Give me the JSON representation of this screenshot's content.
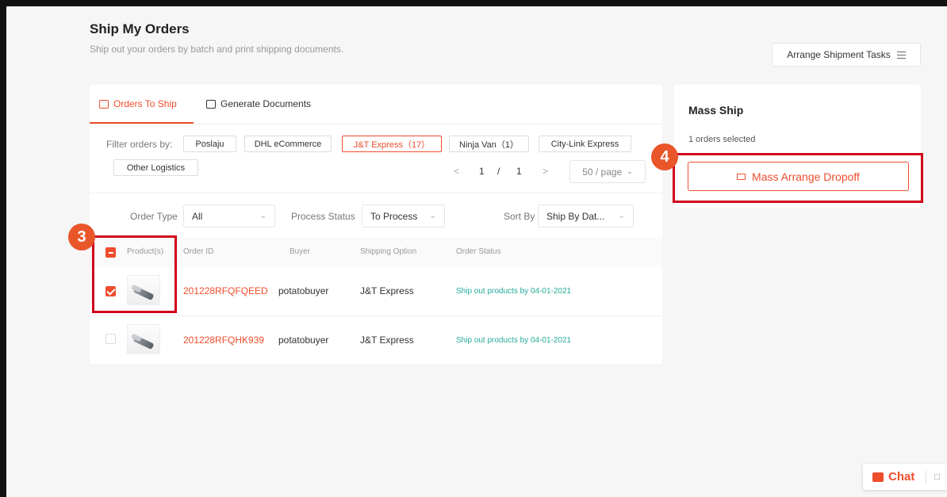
{
  "header": {
    "title": "Ship My Orders",
    "subtitle": "Ship out your orders by batch and print shipping documents.",
    "arrange_tasks_label": "Arrange Shipment Tasks"
  },
  "tabs": [
    {
      "label": "Orders To Ship",
      "active": true
    },
    {
      "label": "Generate Documents",
      "active": false
    }
  ],
  "filters": {
    "label": "Filter orders by:",
    "chips": [
      "Poslaju",
      "DHL eCommerce",
      "J&T Express（17）",
      "Ninja Van（1）",
      "City-Link Express",
      "Other Logistics"
    ],
    "active_chip": "J&T Express（17）"
  },
  "pagination": {
    "prev": "<",
    "current": "1",
    "separator": "/",
    "total": "1",
    "next": ">",
    "per_page": "50 / page"
  },
  "controls": {
    "order_type_label": "Order Type",
    "order_type_value": "All",
    "process_status_label": "Process Status",
    "process_status_value": "To Process",
    "sort_by_label": "Sort By",
    "sort_by_value": "Ship By Dat..."
  },
  "table": {
    "columns": [
      "Product(s)",
      "Order ID",
      "Buyer",
      "Shipping Option",
      "Order Status"
    ],
    "rows": [
      {
        "checked": true,
        "order_id": "201228RFQFQEED",
        "buyer": "potatobuyer",
        "shipping": "J&T Express",
        "status": "Ship out products by 04-01-2021"
      },
      {
        "checked": false,
        "order_id": "201228RFQHK939",
        "buyer": "potatobuyer",
        "shipping": "J&T Express",
        "status": "Ship out products by 04-01-2021"
      }
    ]
  },
  "mass_ship": {
    "title": "Mass Ship",
    "selected_text": "1 orders selected",
    "button_label": "Mass Arrange Dropoff"
  },
  "annotations": {
    "badge_3": "3",
    "badge_4": "4",
    "highlight_color": "#d0021b",
    "badge_color": "#e8562a"
  },
  "chat": {
    "label": "Chat"
  },
  "colors": {
    "accent": "#ee4d2d",
    "status_green": "#26aa99"
  }
}
